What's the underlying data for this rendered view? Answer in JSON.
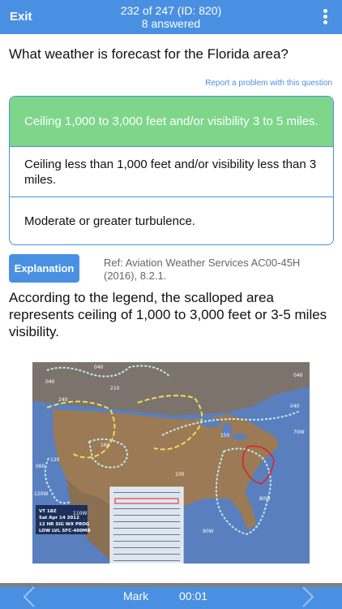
{
  "topbar": {
    "exit_label": "Exit",
    "counter": "232 of 247 (ID: 820)",
    "answered": "8 answered",
    "menu_icon": "more-vertical-icon"
  },
  "question": {
    "text": "What weather is forecast for the Florida area?",
    "report_link": "Report a problem with this question"
  },
  "answers": [
    {
      "text": "Ceiling 1,000 to 3,000 feet and/or visibility 3 to 5 miles.",
      "state": "correct"
    },
    {
      "text": "Ceiling less than 1,000 feet and/or visibility less than 3 miles.",
      "state": "normal"
    },
    {
      "text": "Moderate or greater turbulence.",
      "state": "normal"
    }
  ],
  "explanation": {
    "button_label": "Explanation",
    "reference": "Ref: Aviation Weather Services AC00-45H (2016), 8.2.1.",
    "text": "According to the legend, the scalloped area represents ceiling of 1,000 to 3,000 feet or 3-5 miles visibility."
  },
  "map": {
    "chart_box": {
      "line1": "VT 18Z",
      "line2": "Sat Apr 14 2012",
      "line3": "12 HR SIG WX PROG",
      "line4": "LOW LVL SFC-400MB"
    },
    "labels": {
      "l040a": "040",
      "l040b": "040",
      "l040c": "040",
      "l040d": "040",
      "l240": "240",
      "l210": "210",
      "l160": "160",
      "l060": "060",
      "l120": "120",
      "l70w": "70W",
      "l120w": "120W",
      "l80w": "80W",
      "l90w": "90W",
      "l110w": "110W",
      "l150": "150",
      "l100": "100"
    },
    "colors": {
      "ocean": "#5a7fbf",
      "land": "#9b7a55",
      "ifr": "#c0ecf0",
      "turbulence": "#e8e055",
      "red_area": "#e02020"
    }
  },
  "bottombar": {
    "prev_icon": "chevron-left-icon",
    "next_icon": "chevron-right-icon",
    "mark_label": "Mark",
    "timer": "00:01"
  },
  "colors": {
    "accent": "#4a90e2",
    "correct": "#7ed68a"
  }
}
